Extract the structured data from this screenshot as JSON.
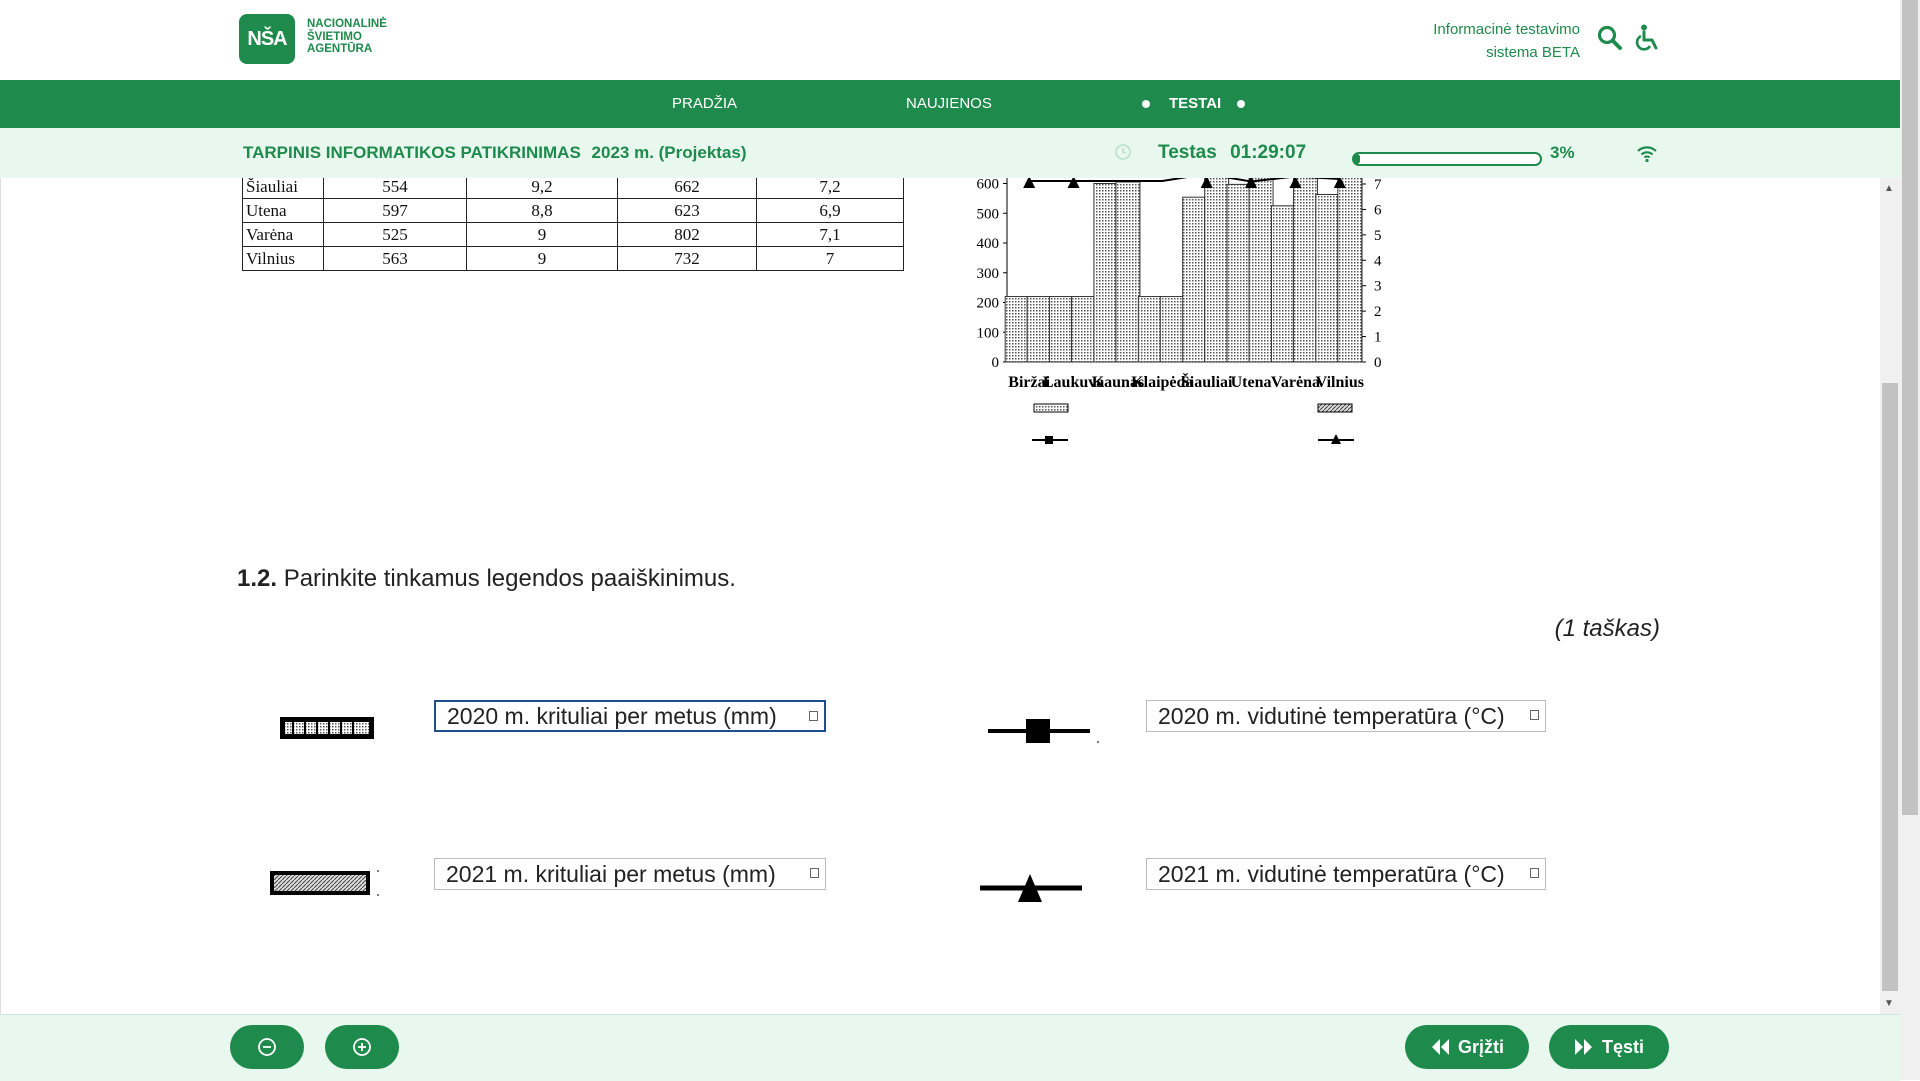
{
  "header": {
    "logo_mark": "NŠA",
    "logo_text": "Nacionalinė Švietimo Agentūra",
    "system_title_line1": "Informacinė testavimo",
    "system_title_line2": "sistema BETA",
    "search_icon": "search-icon",
    "accessibility_icon": "wheelchair-icon"
  },
  "nav": {
    "items": [
      {
        "label": "PRADŽIA"
      },
      {
        "label": "NAUJIENOS"
      },
      {
        "label": "TESTAI"
      }
    ]
  },
  "status": {
    "exam_title": "TARPINIS INFORMATIKOS PATIKRINIMAS",
    "exam_year": "2023 m. (Projektas)",
    "timer_label": "Testas",
    "timer_value": "01:29:07",
    "progress_percent": 3,
    "progress_text": "3%",
    "colors": {
      "brand": "#1e8a4c",
      "light": "#e9f8ef"
    }
  },
  "table": {
    "rows": [
      [
        "Šiauliai",
        "554",
        "9,2",
        "662",
        "7,2"
      ],
      [
        "Utena",
        "597",
        "8,8",
        "623",
        "6,9"
      ],
      [
        "Varėna",
        "525",
        "9",
        "802",
        "7,1"
      ],
      [
        "Vilnius",
        "563",
        "9",
        "732",
        "7"
      ]
    ]
  },
  "chart_data": {
    "type": "bar",
    "categories": [
      "Biržai",
      "Laukuva",
      "Kaunas",
      "Klaipėda",
      "Šiauliai",
      "Utena",
      "Varėna",
      "Vilnius"
    ],
    "series": [
      {
        "values": [
          null,
          null,
          600,
          null,
          554,
          597,
          525,
          563
        ]
      },
      {
        "values": [
          null,
          null,
          605,
          null,
          662,
          623,
          802,
          732
        ]
      }
    ],
    "line_series": [
      {
        "values": [
          null,
          null,
          null,
          null,
          9.2,
          8.8,
          9,
          9
        ]
      },
      {
        "values": [
          null,
          null,
          null,
          null,
          7.2,
          6.9,
          7.1,
          7
        ]
      }
    ],
    "ylim": [
      0,
      600
    ],
    "y_ticks": [
      "0",
      "100",
      "200",
      "300",
      "400",
      "500",
      "600"
    ],
    "y2_ticks": [
      "0",
      "1",
      "2",
      "3",
      "4",
      "5",
      "6",
      "7"
    ],
    "title": "",
    "xlabel": "",
    "ylabel": ""
  },
  "question": {
    "number": "1.2.",
    "text": "Parinkite tinkamus legendos paaiškinimus.",
    "points": "(1 taškas)",
    "selects": [
      {
        "value": "2020 m. krituliai per metus (mm)"
      },
      {
        "value": "2020 m. vidutinė temperatūra (°C)"
      },
      {
        "value": "2021 m. krituliai per metus (mm)"
      },
      {
        "value": "2021 m. vidutinė temperatūra (°C)"
      }
    ]
  },
  "footer": {
    "zoom_out_icon": "zoom-out-icon",
    "zoom_in_icon": "zoom-in-icon",
    "back_label": "Grįžti",
    "next_label": "Tęsti"
  }
}
